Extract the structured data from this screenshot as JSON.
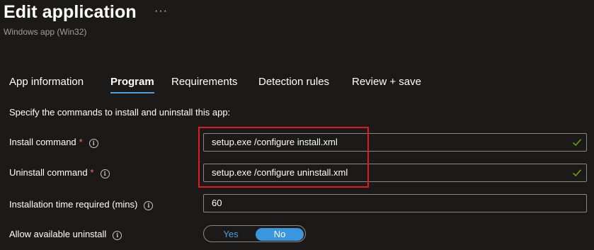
{
  "header": {
    "title": "Edit application",
    "more_label": "···",
    "subtitle": "Windows app (Win32)"
  },
  "tabs": [
    {
      "label": "App information"
    },
    {
      "label": "Program",
      "active": true
    },
    {
      "label": "Requirements"
    },
    {
      "label": "Detection rules"
    },
    {
      "label": "Review + save"
    }
  ],
  "intro": "Specify the commands to install and uninstall this app:",
  "fields": {
    "install": {
      "label": "Install command",
      "required": "*",
      "value": "setup.exe /configure install.xml",
      "info_icon": "info-icon",
      "valid_icon": "checkmark-icon"
    },
    "uninstall": {
      "label": "Uninstall command",
      "required": "*",
      "value": "setup.exe /configure uninstall.xml",
      "info_icon": "info-icon",
      "valid_icon": "checkmark-icon"
    },
    "install_time": {
      "label": "Installation time required (mins)",
      "value": "60",
      "info_icon": "info-icon"
    },
    "allow_uninstall": {
      "label": "Allow available uninstall",
      "info_icon": "info-icon",
      "options": [
        "Yes",
        "No"
      ],
      "selected": "No"
    }
  },
  "colors": {
    "background": "#1b1a19",
    "accent": "#3a96dd",
    "tab_underline": "#4f9fe8",
    "required": "#f1707b",
    "valid_check": "#6bb700",
    "highlight_box": "#e01b24"
  }
}
